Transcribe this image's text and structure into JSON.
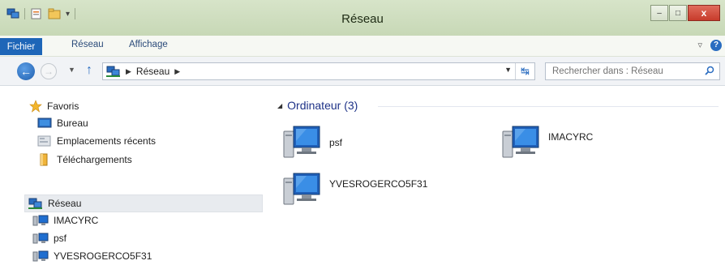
{
  "window": {
    "title": "Réseau"
  },
  "window_controls": {
    "minimize": "–",
    "maximize": "□",
    "close": "x"
  },
  "quick_access": {
    "customize": "▾"
  },
  "ribbon": {
    "tabs": [
      "Fichier",
      "Réseau",
      "Affichage"
    ],
    "expand": "▿",
    "help": "?"
  },
  "address": {
    "crumbs": [
      "Réseau"
    ],
    "search_placeholder": "Rechercher dans : Réseau"
  },
  "nav": {
    "favorites_label": "Favoris",
    "favorites": [
      "Bureau",
      "Emplacements récents",
      "Téléchargements"
    ],
    "network_label": "Réseau",
    "computers": [
      "IMACYRC",
      "psf",
      "YVESROGERCO5F31"
    ]
  },
  "content": {
    "group_label": "Ordinateur (3)",
    "items": [
      "psf",
      "IMACYRC",
      "YVESROGERCO5F31"
    ]
  },
  "colors": {
    "titlebar": "#d0dfc0",
    "accent": "#1e66b8",
    "group_header": "#1e3287"
  },
  "icons": {
    "favorites": "star-icon",
    "desktop": "desktop-icon",
    "recent": "recent-places-icon",
    "downloads": "downloads-folder-icon",
    "network": "network-icon",
    "computer": "computer-monitor-icon"
  }
}
